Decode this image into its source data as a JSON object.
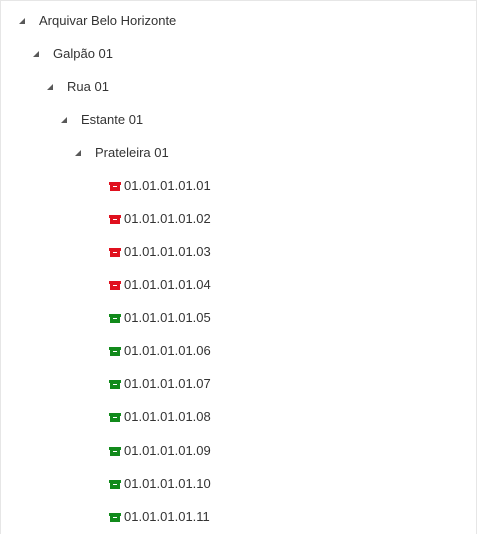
{
  "tree": {
    "root": {
      "label": "Arquivar Belo Horizonte"
    },
    "warehouse": {
      "label": "Galpão 01"
    },
    "street": {
      "label": "Rua 01"
    },
    "shelf_unit": {
      "label": "Estante 01"
    },
    "shelf": {
      "label": "Prateleira 01"
    },
    "slots": [
      {
        "label": "01.01.01.01.01",
        "status_icon": "box-icon",
        "color": "#e0101e"
      },
      {
        "label": "01.01.01.01.02",
        "status_icon": "box-icon",
        "color": "#e0101e"
      },
      {
        "label": "01.01.01.01.03",
        "status_icon": "box-icon",
        "color": "#e0101e"
      },
      {
        "label": "01.01.01.01.04",
        "status_icon": "box-icon",
        "color": "#e0101e"
      },
      {
        "label": "01.01.01.01.05",
        "status_icon": "box-icon",
        "color": "#118a1b"
      },
      {
        "label": "01.01.01.01.06",
        "status_icon": "box-icon",
        "color": "#118a1b"
      },
      {
        "label": "01.01.01.01.07",
        "status_icon": "box-icon",
        "color": "#118a1b"
      },
      {
        "label": "01.01.01.01.08",
        "status_icon": "box-icon",
        "color": "#118a1b"
      },
      {
        "label": "01.01.01.01.09",
        "status_icon": "box-icon",
        "color": "#118a1b"
      },
      {
        "label": "01.01.01.01.10",
        "status_icon": "box-icon",
        "color": "#118a1b"
      },
      {
        "label": "01.01.01.01.11",
        "status_icon": "box-icon",
        "color": "#118a1b"
      }
    ]
  }
}
